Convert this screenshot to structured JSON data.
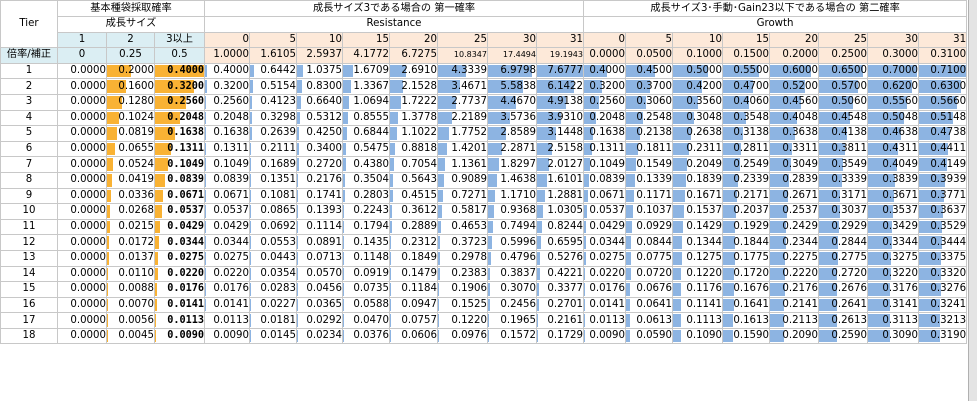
{
  "headers": {
    "tier": "Tier",
    "sec1": "基本種袋採取確率",
    "sec1_sub": "成長サイズ",
    "sec2": "成長サイズ3である場合の 第一確率",
    "sec2_sub": "Resistance",
    "sec3": "成長サイズ3･手動･Gain23以下である場合の 第二確率",
    "sec3_sub": "Growth",
    "rowlabel": "倍率/補正"
  },
  "sec1_cols": [
    "1",
    "2",
    "3以上"
  ],
  "sec1_mult": [
    "0",
    "0.25",
    "0.5"
  ],
  "sec2_cols": [
    "0",
    "5",
    "10",
    "15",
    "20",
    "25",
    "30",
    "31"
  ],
  "sec2_mult": [
    "1.0000",
    "1.6105",
    "2.5937",
    "4.1772",
    "6.7275",
    "10.8347",
    "17.4494",
    "19.1943"
  ],
  "sec3_cols": [
    "0",
    "5",
    "10",
    "15",
    "20",
    "25",
    "30",
    "31"
  ],
  "sec3_mult": [
    "0.0000",
    "0.0500",
    "0.1000",
    "0.1500",
    "0.2000",
    "0.2500",
    "0.3000",
    "0.3100"
  ],
  "colors": {
    "orange": "#f9b234",
    "orange_bold": "#f5a623",
    "blue_bar": "#8db4e2",
    "header_blue": "#dbeef3",
    "header_peach": "#fde9d9"
  },
  "rows": [
    {
      "tier": "1",
      "s1": [
        "0.0000",
        "0.2000",
        "0.4000"
      ],
      "s2": [
        "0.4000",
        "0.6442",
        "1.0375",
        "1.6709",
        "2.6910",
        "4.3339",
        "6.9798",
        "7.6777"
      ],
      "s3": [
        "0.4000",
        "0.4500",
        "0.5000",
        "0.5500",
        "0.6000",
        "0.6500",
        "0.7000",
        "0.7100"
      ]
    },
    {
      "tier": "2",
      "s1": [
        "0.0000",
        "0.1600",
        "0.3200"
      ],
      "s2": [
        "0.3200",
        "0.5154",
        "0.8300",
        "1.3367",
        "2.1528",
        "3.4671",
        "5.5838",
        "6.1422"
      ],
      "s3": [
        "0.3200",
        "0.3700",
        "0.4200",
        "0.4700",
        "0.5200",
        "0.5700",
        "0.6200",
        "0.6300"
      ]
    },
    {
      "tier": "3",
      "s1": [
        "0.0000",
        "0.1280",
        "0.2560"
      ],
      "s2": [
        "0.2560",
        "0.4123",
        "0.6640",
        "1.0694",
        "1.7222",
        "2.7737",
        "4.4670",
        "4.9138"
      ],
      "s3": [
        "0.2560",
        "0.3060",
        "0.3560",
        "0.4060",
        "0.4560",
        "0.5060",
        "0.5560",
        "0.5660"
      ]
    },
    {
      "tier": "4",
      "s1": [
        "0.0000",
        "0.1024",
        "0.2048"
      ],
      "s2": [
        "0.2048",
        "0.3298",
        "0.5312",
        "0.8555",
        "1.3778",
        "2.2189",
        "3.5736",
        "3.9310"
      ],
      "s3": [
        "0.2048",
        "0.2548",
        "0.3048",
        "0.3548",
        "0.4048",
        "0.4548",
        "0.5048",
        "0.5148"
      ]
    },
    {
      "tier": "5",
      "s1": [
        "0.0000",
        "0.0819",
        "0.1638"
      ],
      "s2": [
        "0.1638",
        "0.2639",
        "0.4250",
        "0.6844",
        "1.1022",
        "1.7752",
        "2.8589",
        "3.1448"
      ],
      "s3": [
        "0.1638",
        "0.2138",
        "0.2638",
        "0.3138",
        "0.3638",
        "0.4138",
        "0.4638",
        "0.4738"
      ]
    },
    {
      "tier": "6",
      "s1": [
        "0.0000",
        "0.0655",
        "0.1311"
      ],
      "s2": [
        "0.1311",
        "0.2111",
        "0.3400",
        "0.5475",
        "0.8818",
        "1.4201",
        "2.2871",
        "2.5158"
      ],
      "s3": [
        "0.1311",
        "0.1811",
        "0.2311",
        "0.2811",
        "0.3311",
        "0.3811",
        "0.4311",
        "0.4411"
      ]
    },
    {
      "tier": "7",
      "s1": [
        "0.0000",
        "0.0524",
        "0.1049"
      ],
      "s2": [
        "0.1049",
        "0.1689",
        "0.2720",
        "0.4380",
        "0.7054",
        "1.1361",
        "1.8297",
        "2.0127"
      ],
      "s3": [
        "0.1049",
        "0.1549",
        "0.2049",
        "0.2549",
        "0.3049",
        "0.3549",
        "0.4049",
        "0.4149"
      ]
    },
    {
      "tier": "8",
      "s1": [
        "0.0000",
        "0.0419",
        "0.0839"
      ],
      "s2": [
        "0.0839",
        "0.1351",
        "0.2176",
        "0.3504",
        "0.5643",
        "0.9089",
        "1.4638",
        "1.6101"
      ],
      "s3": [
        "0.0839",
        "0.1339",
        "0.1839",
        "0.2339",
        "0.2839",
        "0.3339",
        "0.3839",
        "0.3939"
      ]
    },
    {
      "tier": "9",
      "s1": [
        "0.0000",
        "0.0336",
        "0.0671"
      ],
      "s2": [
        "0.0671",
        "0.1081",
        "0.1741",
        "0.2803",
        "0.4515",
        "0.7271",
        "1.1710",
        "1.2881"
      ],
      "s3": [
        "0.0671",
        "0.1171",
        "0.1671",
        "0.2171",
        "0.2671",
        "0.3171",
        "0.3671",
        "0.3771"
      ]
    },
    {
      "tier": "10",
      "s1": [
        "0.0000",
        "0.0268",
        "0.0537"
      ],
      "s2": [
        "0.0537",
        "0.0865",
        "0.1393",
        "0.2243",
        "0.3612",
        "0.5817",
        "0.9368",
        "1.0305"
      ],
      "s3": [
        "0.0537",
        "0.1037",
        "0.1537",
        "0.2037",
        "0.2537",
        "0.3037",
        "0.3537",
        "0.3637"
      ]
    },
    {
      "tier": "11",
      "s1": [
        "0.0000",
        "0.0215",
        "0.0429"
      ],
      "s2": [
        "0.0429",
        "0.0692",
        "0.1114",
        "0.1794",
        "0.2889",
        "0.4653",
        "0.7494",
        "0.8244"
      ],
      "s3": [
        "0.0429",
        "0.0929",
        "0.1429",
        "0.1929",
        "0.2429",
        "0.2929",
        "0.3429",
        "0.3529"
      ]
    },
    {
      "tier": "12",
      "s1": [
        "0.0000",
        "0.0172",
        "0.0344"
      ],
      "s2": [
        "0.0344",
        "0.0553",
        "0.0891",
        "0.1435",
        "0.2312",
        "0.3723",
        "0.5996",
        "0.6595"
      ],
      "s3": [
        "0.0344",
        "0.0844",
        "0.1344",
        "0.1844",
        "0.2344",
        "0.2844",
        "0.3344",
        "0.3444"
      ]
    },
    {
      "tier": "13",
      "s1": [
        "0.0000",
        "0.0137",
        "0.0275"
      ],
      "s2": [
        "0.0275",
        "0.0443",
        "0.0713",
        "0.1148",
        "0.1849",
        "0.2978",
        "0.4796",
        "0.5276"
      ],
      "s3": [
        "0.0275",
        "0.0775",
        "0.1275",
        "0.1775",
        "0.2275",
        "0.2775",
        "0.3275",
        "0.3375"
      ]
    },
    {
      "tier": "14",
      "s1": [
        "0.0000",
        "0.0110",
        "0.0220"
      ],
      "s2": [
        "0.0220",
        "0.0354",
        "0.0570",
        "0.0919",
        "0.1479",
        "0.2383",
        "0.3837",
        "0.4221"
      ],
      "s3": [
        "0.0220",
        "0.0720",
        "0.1220",
        "0.1720",
        "0.2220",
        "0.2720",
        "0.3220",
        "0.3320"
      ]
    },
    {
      "tier": "15",
      "s1": [
        "0.0000",
        "0.0088",
        "0.0176"
      ],
      "s2": [
        "0.0176",
        "0.0283",
        "0.0456",
        "0.0735",
        "0.1184",
        "0.1906",
        "0.3070",
        "0.3377"
      ],
      "s3": [
        "0.0176",
        "0.0676",
        "0.1176",
        "0.1676",
        "0.2176",
        "0.2676",
        "0.3176",
        "0.3276"
      ]
    },
    {
      "tier": "16",
      "s1": [
        "0.0000",
        "0.0070",
        "0.0141"
      ],
      "s2": [
        "0.0141",
        "0.0227",
        "0.0365",
        "0.0588",
        "0.0947",
        "0.1525",
        "0.2456",
        "0.2701"
      ],
      "s3": [
        "0.0141",
        "0.0641",
        "0.1141",
        "0.1641",
        "0.2141",
        "0.2641",
        "0.3141",
        "0.3241"
      ]
    },
    {
      "tier": "17",
      "s1": [
        "0.0000",
        "0.0056",
        "0.0113"
      ],
      "s2": [
        "0.0113",
        "0.0181",
        "0.0292",
        "0.0470",
        "0.0757",
        "0.1220",
        "0.1965",
        "0.2161"
      ],
      "s3": [
        "0.0113",
        "0.0613",
        "0.1113",
        "0.1613",
        "0.2113",
        "0.2613",
        "0.3113",
        "0.3213"
      ]
    },
    {
      "tier": "18",
      "s1": [
        "0.0000",
        "0.0045",
        "0.0090"
      ],
      "s2": [
        "0.0090",
        "0.0145",
        "0.0234",
        "0.0376",
        "0.0606",
        "0.0976",
        "0.1572",
        "0.1729"
      ],
      "s3": [
        "0.0090",
        "0.0590",
        "0.1090",
        "0.1590",
        "0.2090",
        "0.2590",
        "0.3090",
        "0.3190"
      ]
    }
  ]
}
